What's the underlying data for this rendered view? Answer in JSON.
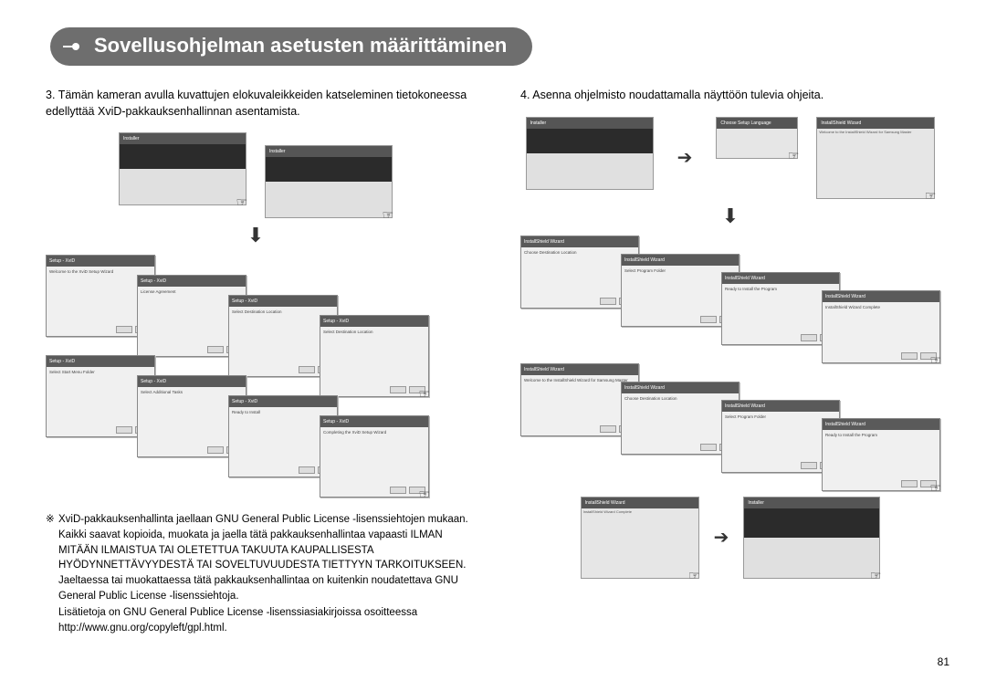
{
  "title": "Sovellusohjelman asetusten määrittäminen",
  "left": {
    "step_num": "3.",
    "step_text": "Tämän kameran avulla kuvattujen elokuvaleikkeiden katseleminen tietokoneessa edellyttää XviD-pakkauksenhallinnan asentamista.",
    "installer_label": "Installer",
    "cascade_titles": {
      "w1": "Welcome to the XviD Setup Wizard",
      "w2": "License Agreement",
      "w3": "Select Destination Location",
      "w4": "Select Start Menu Folder",
      "w5": "Select Additional Tasks",
      "w6": "Ready to Install",
      "w7": "Completing the XviD Setup Wizard"
    }
  },
  "right": {
    "step_num": "4.",
    "step_text": "Asenna ohjelmisto noudattamalla näyttöön tulevia ohjeita.",
    "wiz_titles": {
      "a": "Choose Setup Language",
      "b": "Welcome to the InstallShield Wizard for Samsung Master",
      "c": "Choose Destination Location",
      "d": "Select Program Folder",
      "e": "Ready to Install the Program",
      "f": "Select Program Folder",
      "g": "Ready to Install the Program",
      "h": "InstallShield Wizard Complete",
      "i": "InstallShield Wizard Complete"
    }
  },
  "notes": {
    "sym": "※",
    "line1": "XviD-pakkauksenhallinta jaellaan GNU General Public License -lisenssiehtojen mukaan. Kaikki saavat kopioida, muokata ja jaella tätä pakkauksenhallintaa vapaasti ILMAN MITÄÄN ILMAISTUA TAI OLETETTUA TAKUUTA KAUPALLISESTA HYÖDYNNETTÄVYYDESTÄ TAI SOVELTUVUUDESTA TIETTYYN TARKOITUKSEEN. Jaeltaessa tai muokattaessa tätä pakkauksenhallintaa on kuitenkin noudatettava GNU General Public License -lisenssiehtoja.",
    "line2": "Lisätietoja on GNU General Publice License -lisenssiasiakirjoissa osoitteessa http://www.gnu.org/copyleft/gpl.html."
  },
  "page_number": "81",
  "icons": {
    "hand": "☞",
    "arrow_down": "⬇",
    "arrow_right": "➔"
  }
}
